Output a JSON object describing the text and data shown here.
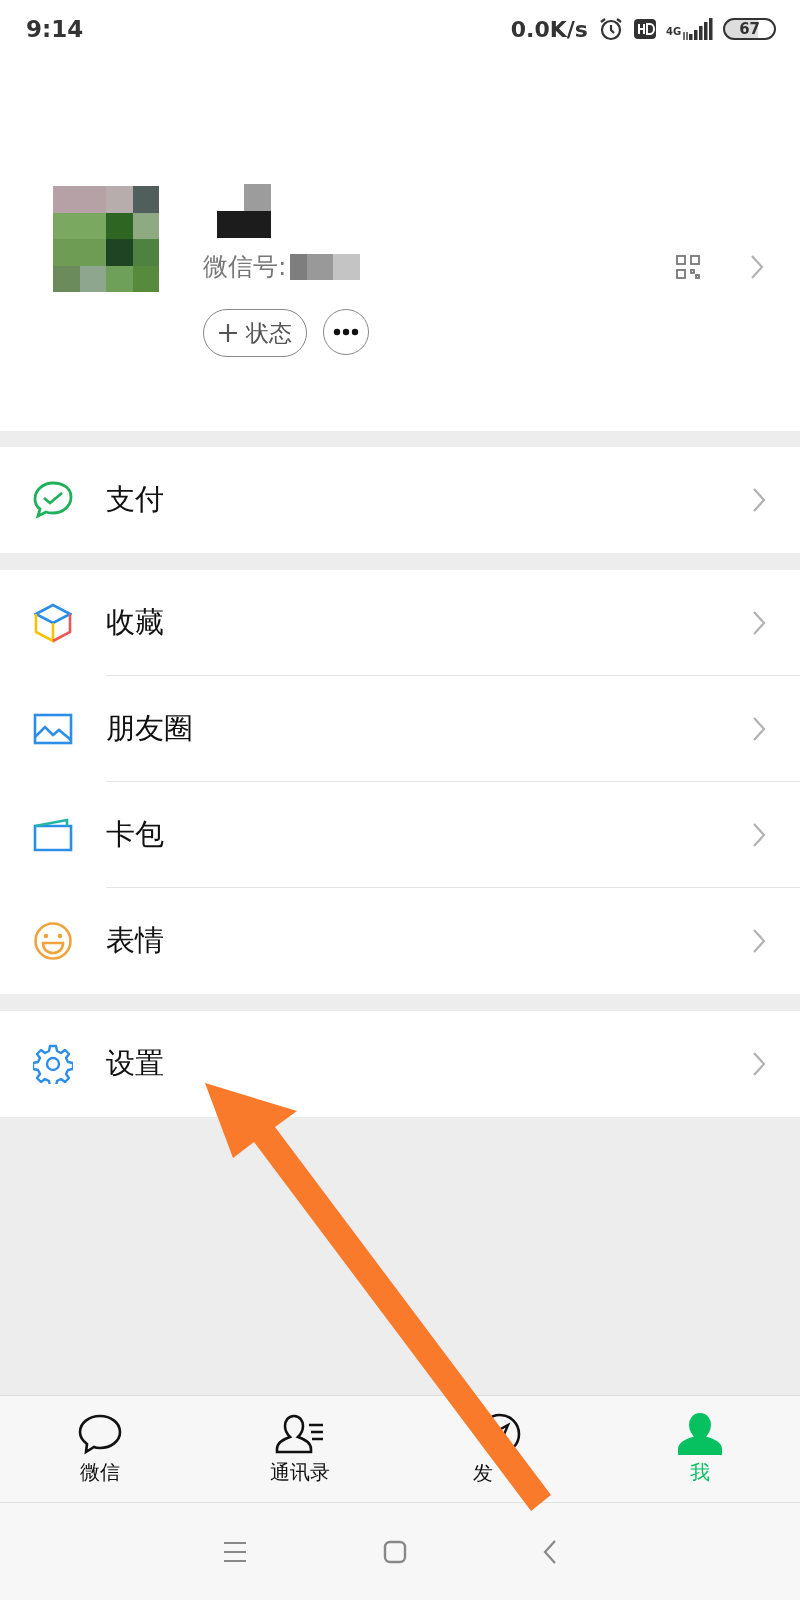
{
  "status_bar": {
    "time": "9:14",
    "speed": "0.0K/s",
    "network": "4G",
    "battery": "67"
  },
  "profile": {
    "id_label": "微信号:",
    "actions": [
      {
        "kind": "status",
        "label": "状态"
      },
      {
        "kind": "more"
      }
    ]
  },
  "menu_groups": [
    [
      {
        "kind": "pay",
        "label": "支付"
      }
    ],
    [
      {
        "kind": "favorites",
        "label": "收藏"
      },
      {
        "kind": "moments",
        "label": "朋友圈"
      },
      {
        "kind": "cards",
        "label": "卡包"
      },
      {
        "kind": "stickers",
        "label": "表情"
      }
    ],
    [
      {
        "kind": "settings",
        "label": "设置"
      }
    ]
  ],
  "tabs": [
    {
      "kind": "chats",
      "label": "微信",
      "selected": false
    },
    {
      "kind": "contacts",
      "label": "通讯录",
      "selected": false
    },
    {
      "kind": "discover",
      "label": "发",
      "selected": false
    },
    {
      "kind": "me",
      "label": "我",
      "selected": true
    }
  ]
}
